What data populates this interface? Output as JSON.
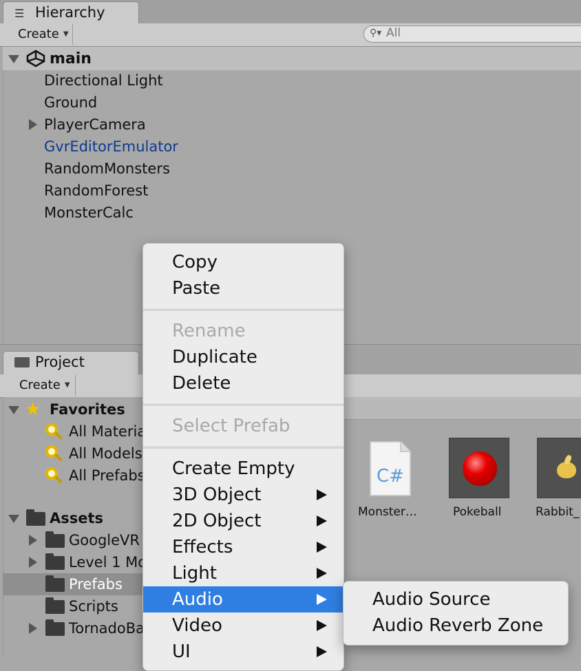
{
  "hierarchy": {
    "tab_label": "Hierarchy",
    "create_label": "Create",
    "search_placeholder": "All",
    "scene_name": "main",
    "items": [
      {
        "label": "Directional Light",
        "expandable": false,
        "active": false
      },
      {
        "label": "Ground",
        "expandable": false,
        "active": false
      },
      {
        "label": "PlayerCamera",
        "expandable": true,
        "active": false
      },
      {
        "label": "GvrEditorEmulator",
        "expandable": false,
        "active": true
      },
      {
        "label": "RandomMonsters",
        "expandable": false,
        "active": false
      },
      {
        "label": "RandomForest",
        "expandable": false,
        "active": false
      },
      {
        "label": "MonsterCalc",
        "expandable": false,
        "active": false
      }
    ]
  },
  "project": {
    "tab_label": "Project",
    "create_label": "Create",
    "favorites": {
      "label": "Favorites",
      "items": [
        "All Materia",
        "All Models",
        "All Prefabs"
      ]
    },
    "assets": {
      "label": "Assets",
      "items": [
        {
          "label": "GoogleVR",
          "expandable": true,
          "selected": false
        },
        {
          "label": "Level 1 Mo",
          "expandable": true,
          "selected": false
        },
        {
          "label": "Prefabs",
          "expandable": false,
          "selected": true
        },
        {
          "label": "Scripts",
          "expandable": false,
          "selected": false
        },
        {
          "label": "TornadoBa",
          "expandable": true,
          "selected": false
        }
      ]
    },
    "grid_assets": [
      {
        "label": "Monster…",
        "icon": "csharp-script-icon"
      },
      {
        "label": "Pokeball",
        "icon": "red-sphere-icon"
      },
      {
        "label": "Rabbit_",
        "icon": "rabbit-model-icon"
      }
    ]
  },
  "context_menu": {
    "items": [
      {
        "label": "Copy",
        "disabled": false,
        "submenu": false
      },
      {
        "label": "Paste",
        "disabled": false,
        "submenu": false
      },
      {
        "label": "Rename",
        "disabled": true,
        "submenu": false
      },
      {
        "label": "Duplicate",
        "disabled": false,
        "submenu": false
      },
      {
        "label": "Delete",
        "disabled": false,
        "submenu": false
      },
      {
        "label": "Select Prefab",
        "disabled": true,
        "submenu": false
      },
      {
        "label": "Create Empty",
        "disabled": false,
        "submenu": false
      },
      {
        "label": "3D Object",
        "disabled": false,
        "submenu": true
      },
      {
        "label": "2D Object",
        "disabled": false,
        "submenu": true
      },
      {
        "label": "Effects",
        "disabled": false,
        "submenu": true
      },
      {
        "label": "Light",
        "disabled": false,
        "submenu": true
      },
      {
        "label": "Audio",
        "disabled": false,
        "submenu": true,
        "highlighted": true
      },
      {
        "label": "Video",
        "disabled": false,
        "submenu": true
      },
      {
        "label": "UI",
        "disabled": false,
        "submenu": true
      }
    ],
    "audio_submenu": [
      "Audio Source",
      "Audio Reverb Zone"
    ],
    "highlight_color": "#2f7fe2"
  },
  "colors": {
    "panel_bg": "#a8a8a8",
    "toolbar_bg": "#cbcbcb",
    "active_object_text": "#0e3a8c"
  }
}
